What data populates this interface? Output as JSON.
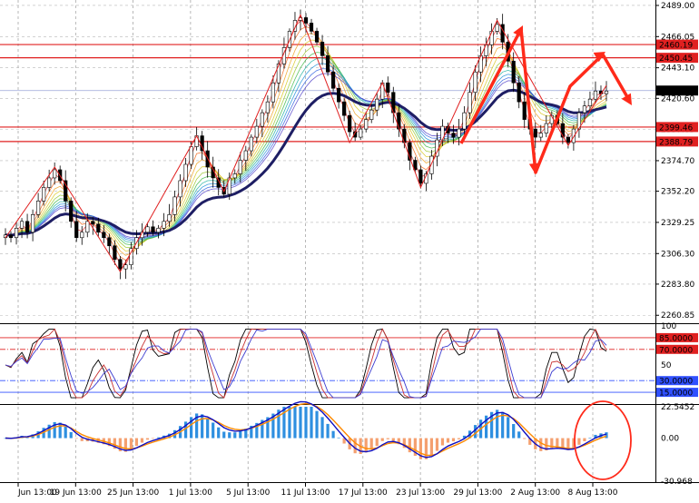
{
  "chart_data": [
    {
      "type": "candlestick",
      "panel": "price",
      "ohlc_path": [
        2320,
        2318,
        2325,
        2330,
        2322,
        2335,
        2345,
        2355,
        2362,
        2368,
        2360,
        2345,
        2330,
        2318,
        2322,
        2330,
        2328,
        2322,
        2318,
        2312,
        2302,
        2295,
        2298,
        2310,
        2318,
        2322,
        2326,
        2322,
        2325,
        2330,
        2335,
        2348,
        2360,
        2372,
        2385,
        2393,
        2382,
        2370,
        2362,
        2355,
        2350,
        2362,
        2365,
        2375,
        2382,
        2392,
        2400,
        2410,
        2418,
        2432,
        2446,
        2458,
        2470,
        2478,
        2480,
        2476,
        2470,
        2462,
        2452,
        2440,
        2428,
        2418,
        2408,
        2396,
        2392,
        2398,
        2405,
        2412,
        2420,
        2432,
        2425,
        2410,
        2398,
        2388,
        2375,
        2368,
        2358,
        2365,
        2378,
        2390,
        2400,
        2395,
        2392,
        2398,
        2410,
        2425,
        2440,
        2452,
        2460,
        2470,
        2475,
        2462,
        2448,
        2432,
        2418,
        2405,
        2398,
        2392,
        2395,
        2402,
        2408,
        2402,
        2392,
        2388,
        2398,
        2410,
        2415,
        2420,
        2426,
        2424,
        2426
      ],
      "right_axis_ticks": [
        "2489.00",
        "2466.05",
        "2443.10",
        "2420.60",
        "2397.65",
        "2374.70",
        "2352.20",
        "2329.25",
        "2306.30",
        "2283.80",
        "2260.85"
      ],
      "horizontal_levels": [
        {
          "value": "2460.19",
          "color": "#e02020"
        },
        {
          "value": "2450.45",
          "color": "#e02020"
        },
        {
          "value": "2399.46",
          "color": "#e02020"
        },
        {
          "value": "2388.79",
          "color": "#e02020"
        }
      ],
      "current_price": "2426.32",
      "moving_average_ribbon": "rainbow (red to blue)",
      "slow_moving_average_color": "#1e1e64",
      "zigzag_color": "#e02020",
      "annotation_arrows_color": "#ff2a1a",
      "ylim": [
        2255,
        2493
      ]
    },
    {
      "type": "line",
      "panel": "oscillator",
      "right_axis_ticks": [
        "100",
        "50",
        "0"
      ],
      "levels": [
        {
          "value": "85.0000",
          "color": "#e02020",
          "style": "solid"
        },
        {
          "value": "70.0000",
          "color": "#e02020",
          "style": "dashdot"
        },
        {
          "value": "30.0000",
          "color": "#3050ff",
          "style": "dashdot"
        },
        {
          "value": "15.0000",
          "color": "#3050ff",
          "style": "solid"
        }
      ],
      "series_colors": [
        "#000000",
        "#c83232",
        "#3c3cd0"
      ],
      "ylim": [
        0,
        100
      ]
    },
    {
      "type": "bar",
      "panel": "macd",
      "right_axis_ticks": [
        "22.5452",
        "0.00",
        "-30.968"
      ],
      "positive_color": "#2e8fe0",
      "negative_color": "#f4a070",
      "signal_color": "#ff8a00",
      "macd_line_color": "#1010c0",
      "highlight_circle_color": "#ff2a1a",
      "ylim": [
        -30.968,
        22.5452
      ]
    }
  ],
  "x_axis": {
    "labels": [
      "Jun 13:00",
      "19 Jun 13:00",
      "25 Jun 13:00",
      "1 Jul 13:00",
      "5 Jul 13:00",
      "11 Jul 13:00",
      "17 Jul 13:00",
      "23 Jul 13:00",
      "29 Jul 13:00",
      "2 Aug 13:00",
      "8 Aug 13:00"
    ]
  }
}
